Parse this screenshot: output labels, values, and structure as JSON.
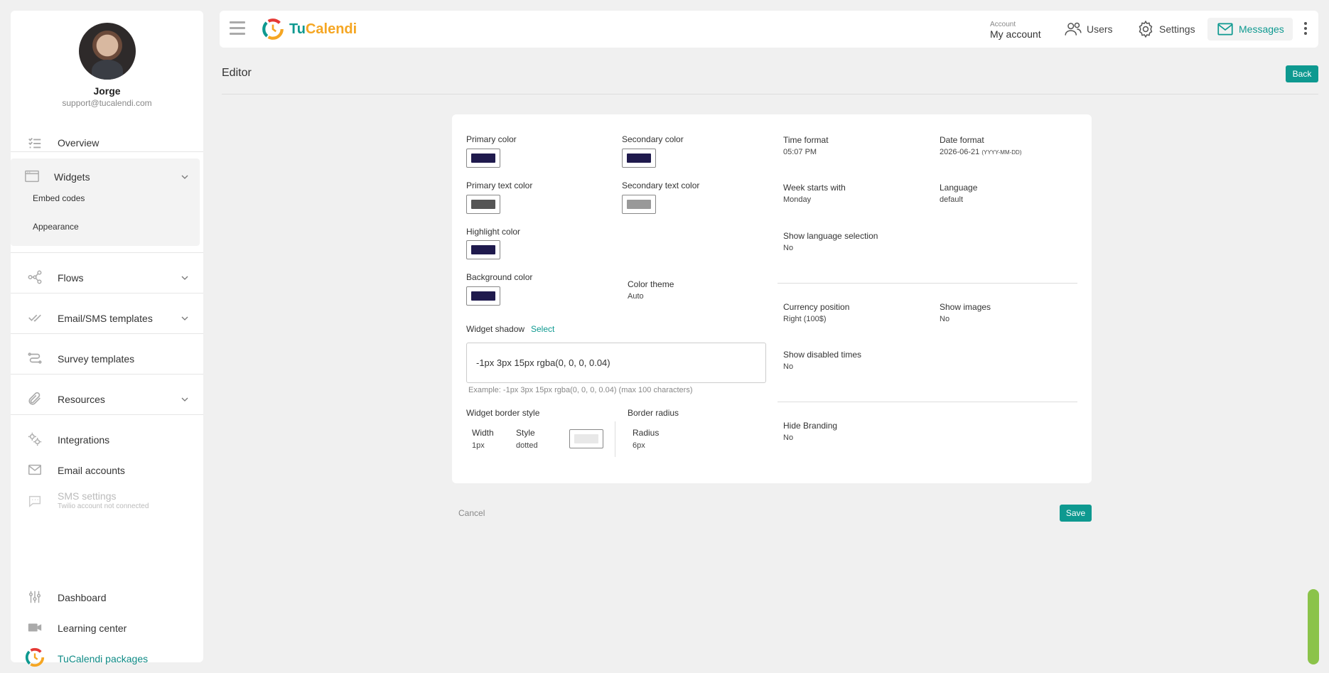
{
  "profile": {
    "name": "Jorge",
    "email": "support@tucalendi.com"
  },
  "sidebar": {
    "overview": "Overview",
    "widgets": "Widgets",
    "embed_codes": "Embed codes",
    "appearance": "Appearance",
    "flows": "Flows",
    "email_sms_templates": "Email/SMS templates",
    "survey_templates": "Survey templates",
    "resources": "Resources",
    "integrations": "Integrations",
    "email_accounts": "Email accounts",
    "sms_settings": "SMS settings",
    "sms_sub": "Twilio account not connected",
    "dashboard": "Dashboard",
    "learning_center": "Learning center",
    "packages": "TuCalendi packages"
  },
  "header": {
    "logo_tu": "Tu",
    "logo_cal": "Calendi",
    "account_small": "Account",
    "account_big": "My account",
    "users": "Users",
    "settings": "Settings",
    "messages": "Messages"
  },
  "page": {
    "title": "Editor",
    "back": "Back",
    "cancel": "Cancel",
    "save": "Save"
  },
  "editor": {
    "primary_color": {
      "label": "Primary color",
      "value": "#1f1a4d"
    },
    "secondary_color": {
      "label": "Secondary color",
      "value": "#1f1a4d"
    },
    "primary_text_color": {
      "label": "Primary text color",
      "value": "#555555"
    },
    "secondary_text_color": {
      "label": "Secondary text color",
      "value": "#999999"
    },
    "highlight_color": {
      "label": "Highlight color",
      "value": "#1f1a4d"
    },
    "background_color": {
      "label": "Background color",
      "value": "#1f1a4d"
    },
    "color_theme": {
      "label": "Color theme",
      "value": "Auto"
    },
    "widget_shadow": {
      "label": "Widget shadow",
      "select": "Select",
      "value": "-1px 3px 15px rgba(0, 0, 0, 0.04)",
      "hint": "Example: -1px 3px 15px rgba(0, 0, 0, 0.04) (max 100 characters)"
    },
    "border_style": {
      "label": "Widget border style",
      "width_label": "Width",
      "width_value": "1px",
      "style_label": "Style",
      "style_value": "dotted",
      "color_value": "#e8e8e8"
    },
    "border_radius": {
      "label": "Border radius",
      "radius_label": "Radius",
      "radius_value": "6px"
    },
    "time_format": {
      "label": "Time format",
      "value": "05:07 PM"
    },
    "date_format": {
      "label": "Date format",
      "value": "2026-06-21",
      "suffix": "(YYYY-MM-DD)"
    },
    "week_starts": {
      "label": "Week starts with",
      "value": "Monday"
    },
    "language": {
      "label": "Language",
      "value": "default"
    },
    "show_language": {
      "label": "Show language selection",
      "value": "No"
    },
    "currency_position": {
      "label": "Currency position",
      "value": "Right (100$)"
    },
    "show_images": {
      "label": "Show images",
      "value": "No"
    },
    "show_disabled": {
      "label": "Show disabled times",
      "value": "No"
    },
    "hide_branding": {
      "label": "Hide Branding",
      "value": "No"
    }
  },
  "colors": {
    "accent": "#0e9990",
    "scroll_tab": "#8bc34a"
  }
}
